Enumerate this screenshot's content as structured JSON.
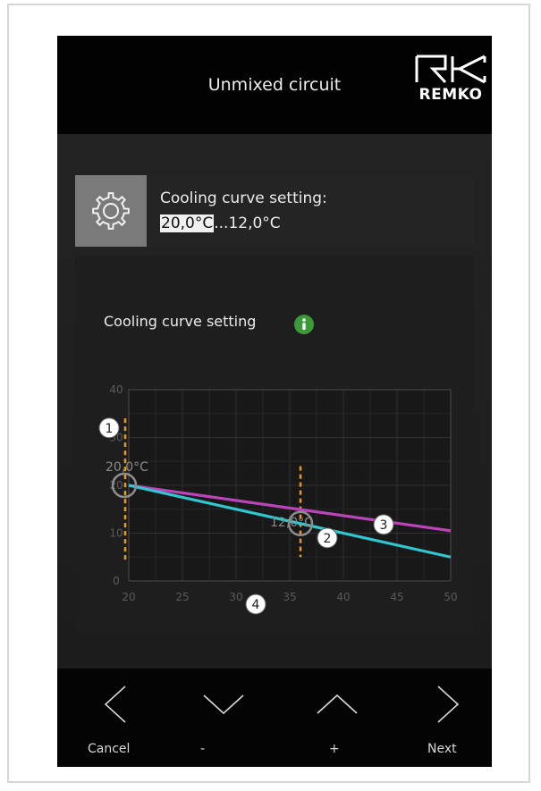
{
  "header": {
    "title": "Unmixed circuit",
    "logo_text": "REMKO"
  },
  "setting": {
    "title": "Cooling curve setting:",
    "highlighted_value": "20,0°C",
    "value_rest": "...12,0°C",
    "icon": "gear-icon"
  },
  "panel": {
    "label": "Cooling curve setting",
    "info_icon": "info-icon",
    "info_color": "#3a9a3a"
  },
  "chart_data": {
    "type": "line",
    "x_ticks": [
      "20",
      "25",
      "30",
      "35",
      "40",
      "45",
      "50"
    ],
    "y_ticks": [
      "0",
      "10",
      "20",
      "30",
      "40"
    ],
    "xlim": [
      20,
      50
    ],
    "ylim": [
      0,
      40
    ],
    "grid": true,
    "series": [
      {
        "color": "#bb44bb",
        "x": [
          20,
          50
        ],
        "y": [
          20,
          10.5
        ]
      },
      {
        "color": "#2ec8d0",
        "x": [
          20,
          50
        ],
        "y": [
          20,
          5
        ]
      }
    ],
    "point_labels": [
      "20,0°C",
      "12,0°C"
    ],
    "set_points": [
      {
        "x": 20,
        "y": 20
      },
      {
        "x": 36,
        "y": 12
      }
    ],
    "markers": [
      "1",
      "2",
      "3",
      "4"
    ]
  },
  "footer": {
    "buttons": [
      {
        "label": "Cancel",
        "icon": "chevron-left-icon"
      },
      {
        "label": "-",
        "icon": "chevron-down-icon"
      },
      {
        "label": "+",
        "icon": "chevron-up-icon"
      },
      {
        "label": "Next",
        "icon": "chevron-right-icon"
      }
    ]
  }
}
